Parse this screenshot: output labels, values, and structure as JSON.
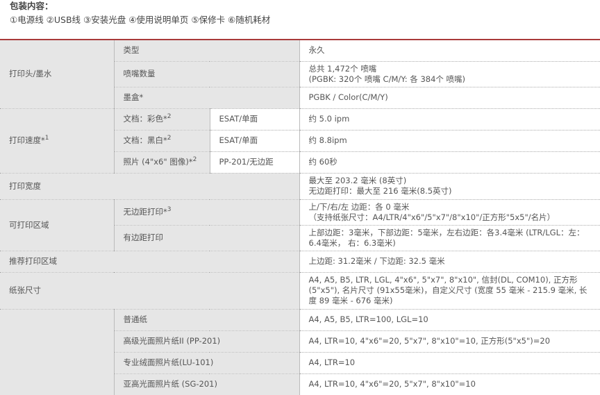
{
  "package": {
    "title": "包装内容：",
    "items": "①电源线 ②USB线 ③安装光盘 ④使用说明单页 ⑤保修卡 ⑥随机耗材"
  },
  "rows": {
    "printhead": {
      "label": "打印头/墨水",
      "type_label": "类型",
      "type_value": "永久",
      "nozzles_label": "喷嘴数量",
      "nozzles_value1": "总共 1,472个 喷嘴",
      "nozzles_value2": "(PGBK: 320个 喷嘴 C/M/Y: 各 384个 喷嘴)",
      "ink_label": "墨盒*",
      "ink_value": "PGBK / Color(C/M/Y)"
    },
    "speed": {
      "label": "打印速度*",
      "label_sup": "1",
      "color_label": "文档：彩色*",
      "color_sup": "2",
      "color_mode": "ESAT/单面",
      "color_value": "约 5.0 ipm",
      "mono_label": "文档：黑白*",
      "mono_sup": "2",
      "mono_mode": "ESAT/单面",
      "mono_value": "约 8.8ipm",
      "photo_label": "照片 (4\"x6\" 图像)*",
      "photo_sup": "2",
      "photo_mode": "PP-201/无边距",
      "photo_value": "约 60秒"
    },
    "width": {
      "label": "打印宽度",
      "value1": "最大至 203.2 毫米 (8英寸)",
      "value2": "无边距打印：最大至 216 毫米(8.5英寸)"
    },
    "area": {
      "label": "可打印区域",
      "borderless_label": "无边距打印*",
      "borderless_sup": "3",
      "borderless_value1": "上/下/右/左 边距：各 0 毫米",
      "borderless_value2": "（支持纸张尺寸：A4/LTR/4\"x6\"/5\"x7\"/8\"x10\"/正方形\"5x5\"/名片）",
      "bordered_label": "有边距打印",
      "bordered_value": "上部边距：3毫米，下部边距：5毫米，左右边距：各3.4毫米 (LTR/LGL：左：6.4毫米， 右：6.3毫米)"
    },
    "recommended": {
      "label": "推荐打印区域",
      "value": "上边距: 31.2毫米 / 下边距: 32.5 毫米"
    },
    "paper_size": {
      "label": "纸张尺寸",
      "value": "A4, A5, B5, LTR, LGL, 4\"x6\", 5\"x7\", 8\"x10\", 信封(DL, COM10), 正方形(5\"x5\"), 名片尺寸 (91x55毫米)，自定义尺寸 (宽度 55 毫米 - 215.9 毫米, 长度 89 毫米 - 676 毫米)"
    },
    "media": [
      {
        "label": "普通纸",
        "value": "A4, A5, B5, LTR=100, LGL=10"
      },
      {
        "label": "高级光面照片纸II (PP-201)",
        "value": "A4, LTR=10, 4\"x6\"=20, 5\"x7\", 8\"x10\"=10, 正方形(5\"x5\")=20"
      },
      {
        "label": "专业绒面照片纸(LU-101)",
        "value": "A4, LTR=10"
      },
      {
        "label": "亚高光面照片纸 (SG-201)",
        "value": "A4, LTR=10, 4\"x6\"=20, 5\"x7\", 8\"x10\"=10"
      }
    ]
  }
}
